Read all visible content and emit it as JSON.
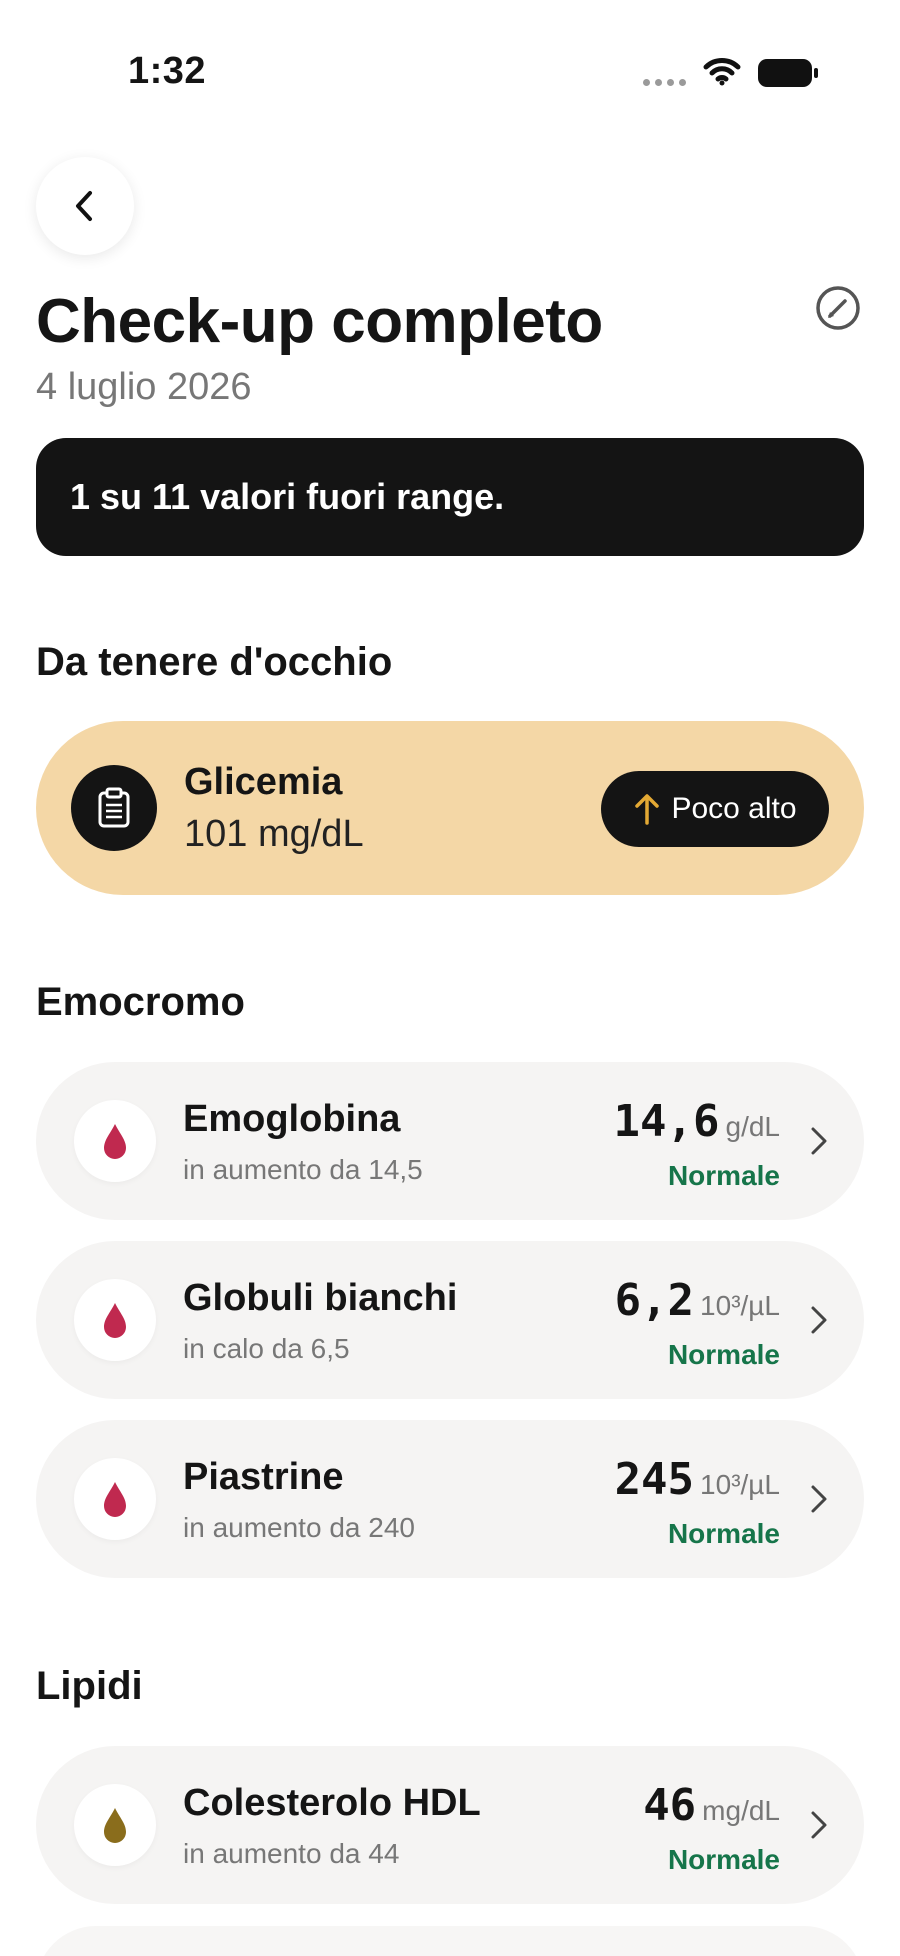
{
  "status_bar": {
    "time": "1:32",
    "icons": [
      "signal-dots-icon",
      "wifi-icon",
      "battery-icon"
    ]
  },
  "header": {
    "back_icon": "chevron-left-icon",
    "edit_icon": "edit-pencil-circle-icon",
    "title": "Check-up completo",
    "date": "4 luglio 2026"
  },
  "summary": {
    "text": "1 su 11 valori fuori range."
  },
  "watch_section": {
    "title": "Da tenere d'occhio",
    "items": [
      {
        "icon": "clipboard-icon",
        "name": "Glicemia",
        "value": "101 mg/dL",
        "badge_icon": "arrow-up-icon",
        "badge": "Poco alto"
      }
    ]
  },
  "sections": [
    {
      "title": "Emocromo",
      "items": [
        {
          "icon": "blood-drop-icon",
          "name": "Emoglobina",
          "trend": "in aumento da 14,5",
          "value": "14,6",
          "unit": "g/dL",
          "status": "Normale"
        },
        {
          "icon": "blood-drop-icon",
          "name": "Globuli bianchi",
          "trend": "in calo da 6,5",
          "value": "6,2",
          "unit": "10³/µL",
          "status": "Normale"
        },
        {
          "icon": "blood-drop-icon",
          "name": "Piastrine",
          "trend": "in aumento da 240",
          "value": "245",
          "unit": "10³/µL",
          "status": "Normale"
        }
      ]
    },
    {
      "title": "Lipidi",
      "items": [
        {
          "icon": "oil-drop-icon",
          "name": "Colesterolo HDL",
          "trend": "in aumento da 44",
          "value": "46",
          "unit": "mg/dL",
          "status": "Normale"
        }
      ]
    }
  ],
  "colors": {
    "banner_bg": "#141414",
    "alert_bg": "#f4d7a6",
    "card_bg": "#f5f4f3",
    "normal_status": "#16754a",
    "blood_drop": "#c0294f",
    "oil_drop": "#8a6d1c",
    "arrow_up": "#e3a934"
  }
}
